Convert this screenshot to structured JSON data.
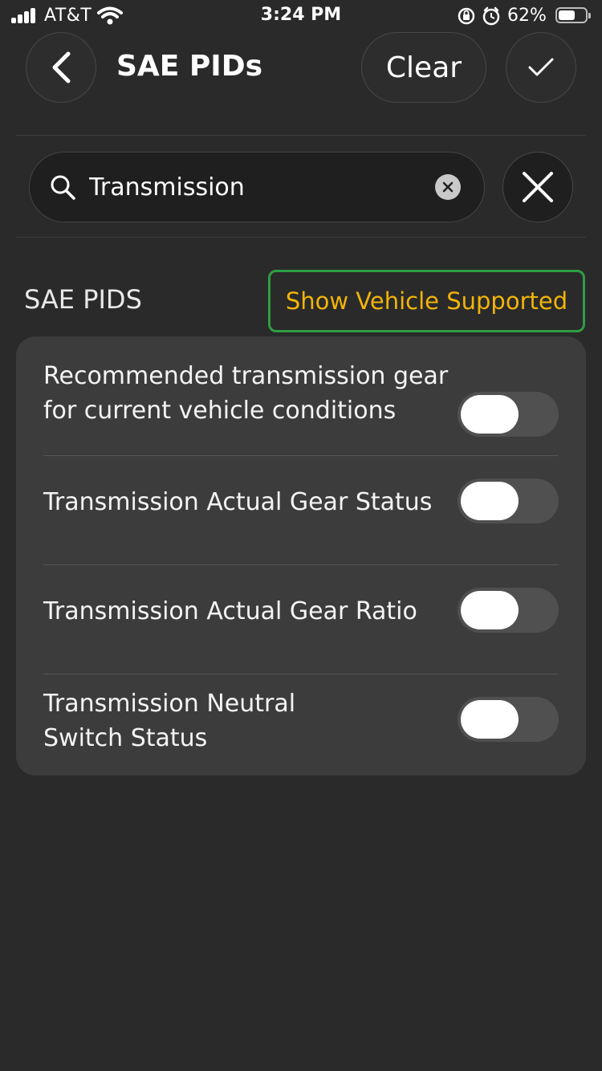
{
  "status_bar": {
    "carrier": "AT&T",
    "time": "3:24 PM",
    "battery_percent": "62%",
    "battery_level": 0.62
  },
  "header": {
    "title": "SAE PIDs",
    "clear_label": "Clear"
  },
  "search": {
    "value": "Transmission",
    "placeholder": ""
  },
  "section": {
    "label": "SAE PIDS",
    "filter_label": "Show Vehicle Supported"
  },
  "pids": [
    {
      "label": "Recommended transmission gear for current vehicle conditions",
      "enabled": false
    },
    {
      "label": "Transmission Actual Gear Status",
      "enabled": false
    },
    {
      "label": "Transmission Actual Gear Ratio",
      "enabled": false
    },
    {
      "label": "Transmission Neutral Switch Status",
      "enabled": false
    }
  ],
  "colors": {
    "background": "#2a2a2a",
    "card": "#3c3c3c",
    "accent_text": "#f2b409",
    "filter_border": "#2e9e43"
  }
}
